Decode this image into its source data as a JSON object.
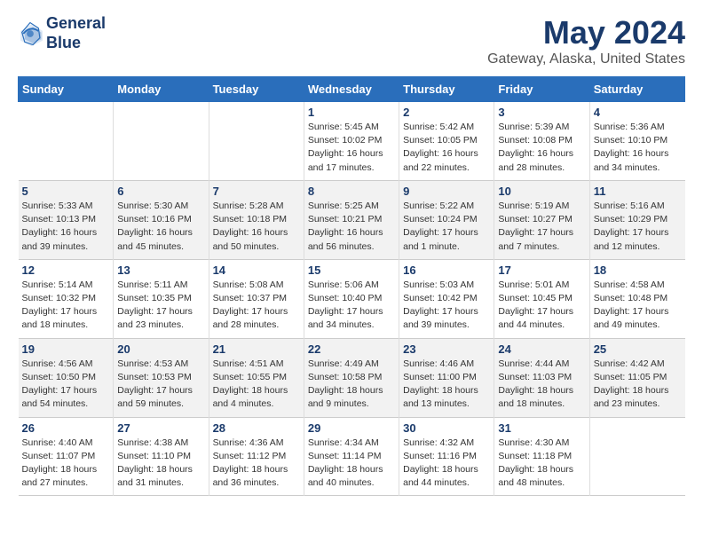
{
  "header": {
    "logo_line1": "General",
    "logo_line2": "Blue",
    "title": "May 2024",
    "subtitle": "Gateway, Alaska, United States"
  },
  "days_of_week": [
    "Sunday",
    "Monday",
    "Tuesday",
    "Wednesday",
    "Thursday",
    "Friday",
    "Saturday"
  ],
  "weeks": [
    [
      {
        "num": "",
        "info": ""
      },
      {
        "num": "",
        "info": ""
      },
      {
        "num": "",
        "info": ""
      },
      {
        "num": "1",
        "info": "Sunrise: 5:45 AM\nSunset: 10:02 PM\nDaylight: 16 hours\nand 17 minutes."
      },
      {
        "num": "2",
        "info": "Sunrise: 5:42 AM\nSunset: 10:05 PM\nDaylight: 16 hours\nand 22 minutes."
      },
      {
        "num": "3",
        "info": "Sunrise: 5:39 AM\nSunset: 10:08 PM\nDaylight: 16 hours\nand 28 minutes."
      },
      {
        "num": "4",
        "info": "Sunrise: 5:36 AM\nSunset: 10:10 PM\nDaylight: 16 hours\nand 34 minutes."
      }
    ],
    [
      {
        "num": "5",
        "info": "Sunrise: 5:33 AM\nSunset: 10:13 PM\nDaylight: 16 hours\nand 39 minutes."
      },
      {
        "num": "6",
        "info": "Sunrise: 5:30 AM\nSunset: 10:16 PM\nDaylight: 16 hours\nand 45 minutes."
      },
      {
        "num": "7",
        "info": "Sunrise: 5:28 AM\nSunset: 10:18 PM\nDaylight: 16 hours\nand 50 minutes."
      },
      {
        "num": "8",
        "info": "Sunrise: 5:25 AM\nSunset: 10:21 PM\nDaylight: 16 hours\nand 56 minutes."
      },
      {
        "num": "9",
        "info": "Sunrise: 5:22 AM\nSunset: 10:24 PM\nDaylight: 17 hours\nand 1 minute."
      },
      {
        "num": "10",
        "info": "Sunrise: 5:19 AM\nSunset: 10:27 PM\nDaylight: 17 hours\nand 7 minutes."
      },
      {
        "num": "11",
        "info": "Sunrise: 5:16 AM\nSunset: 10:29 PM\nDaylight: 17 hours\nand 12 minutes."
      }
    ],
    [
      {
        "num": "12",
        "info": "Sunrise: 5:14 AM\nSunset: 10:32 PM\nDaylight: 17 hours\nand 18 minutes."
      },
      {
        "num": "13",
        "info": "Sunrise: 5:11 AM\nSunset: 10:35 PM\nDaylight: 17 hours\nand 23 minutes."
      },
      {
        "num": "14",
        "info": "Sunrise: 5:08 AM\nSunset: 10:37 PM\nDaylight: 17 hours\nand 28 minutes."
      },
      {
        "num": "15",
        "info": "Sunrise: 5:06 AM\nSunset: 10:40 PM\nDaylight: 17 hours\nand 34 minutes."
      },
      {
        "num": "16",
        "info": "Sunrise: 5:03 AM\nSunset: 10:42 PM\nDaylight: 17 hours\nand 39 minutes."
      },
      {
        "num": "17",
        "info": "Sunrise: 5:01 AM\nSunset: 10:45 PM\nDaylight: 17 hours\nand 44 minutes."
      },
      {
        "num": "18",
        "info": "Sunrise: 4:58 AM\nSunset: 10:48 PM\nDaylight: 17 hours\nand 49 minutes."
      }
    ],
    [
      {
        "num": "19",
        "info": "Sunrise: 4:56 AM\nSunset: 10:50 PM\nDaylight: 17 hours\nand 54 minutes."
      },
      {
        "num": "20",
        "info": "Sunrise: 4:53 AM\nSunset: 10:53 PM\nDaylight: 17 hours\nand 59 minutes."
      },
      {
        "num": "21",
        "info": "Sunrise: 4:51 AM\nSunset: 10:55 PM\nDaylight: 18 hours\nand 4 minutes."
      },
      {
        "num": "22",
        "info": "Sunrise: 4:49 AM\nSunset: 10:58 PM\nDaylight: 18 hours\nand 9 minutes."
      },
      {
        "num": "23",
        "info": "Sunrise: 4:46 AM\nSunset: 11:00 PM\nDaylight: 18 hours\nand 13 minutes."
      },
      {
        "num": "24",
        "info": "Sunrise: 4:44 AM\nSunset: 11:03 PM\nDaylight: 18 hours\nand 18 minutes."
      },
      {
        "num": "25",
        "info": "Sunrise: 4:42 AM\nSunset: 11:05 PM\nDaylight: 18 hours\nand 23 minutes."
      }
    ],
    [
      {
        "num": "26",
        "info": "Sunrise: 4:40 AM\nSunset: 11:07 PM\nDaylight: 18 hours\nand 27 minutes."
      },
      {
        "num": "27",
        "info": "Sunrise: 4:38 AM\nSunset: 11:10 PM\nDaylight: 18 hours\nand 31 minutes."
      },
      {
        "num": "28",
        "info": "Sunrise: 4:36 AM\nSunset: 11:12 PM\nDaylight: 18 hours\nand 36 minutes."
      },
      {
        "num": "29",
        "info": "Sunrise: 4:34 AM\nSunset: 11:14 PM\nDaylight: 18 hours\nand 40 minutes."
      },
      {
        "num": "30",
        "info": "Sunrise: 4:32 AM\nSunset: 11:16 PM\nDaylight: 18 hours\nand 44 minutes."
      },
      {
        "num": "31",
        "info": "Sunrise: 4:30 AM\nSunset: 11:18 PM\nDaylight: 18 hours\nand 48 minutes."
      },
      {
        "num": "",
        "info": ""
      }
    ]
  ]
}
